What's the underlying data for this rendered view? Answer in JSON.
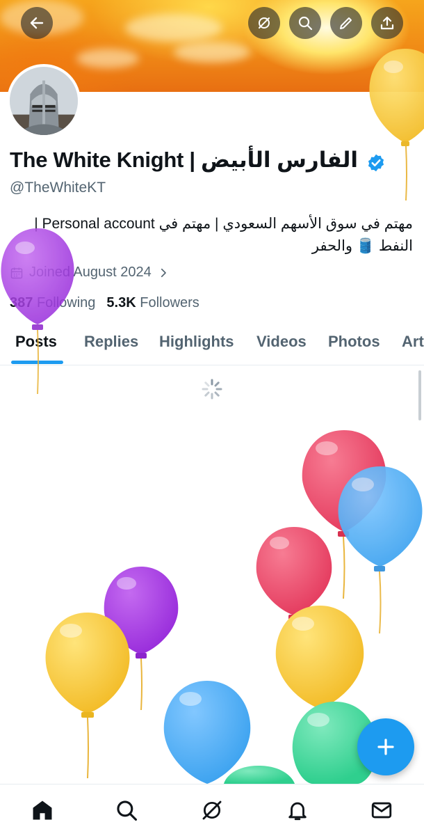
{
  "header": {
    "back_icon": "arrow-left-icon",
    "actions": [
      "grok-icon",
      "search-icon",
      "edit-pencil-icon",
      "share-upload-icon"
    ]
  },
  "profile": {
    "name": "The White Knight | الفارس الأبيض",
    "handle": "@TheWhiteKT",
    "verified": true,
    "bio_line1": "مهتم في سوق الأسهم السعودي | مهتم في Personal account |",
    "bio_line2": "النفط 🛢️ والحفر",
    "joined": "Joined August 2024",
    "following_count": "387",
    "following_label": "Following",
    "followers_count": "5.3K",
    "followers_label": "Followers"
  },
  "tabs": [
    {
      "label": "Posts",
      "active": true
    },
    {
      "label": "Replies",
      "active": false
    },
    {
      "label": "Highlights",
      "active": false
    },
    {
      "label": "Videos",
      "active": false
    },
    {
      "label": "Photos",
      "active": false
    },
    {
      "label": "Articles",
      "active": false
    }
  ],
  "fab": {
    "icon": "plus-icon"
  },
  "bottom_nav": [
    "home-icon",
    "search-icon",
    "grok-icon",
    "notifications-bell-icon",
    "messages-mail-icon"
  ],
  "colors": {
    "accent": "#1d9bf0",
    "text_primary": "#0f1419",
    "text_secondary": "#536471"
  },
  "decorations": {
    "balloon_colors": [
      "#f7c83a",
      "#a83be0",
      "#ea4f6d",
      "#58b3f3",
      "#3ed69a"
    ]
  }
}
